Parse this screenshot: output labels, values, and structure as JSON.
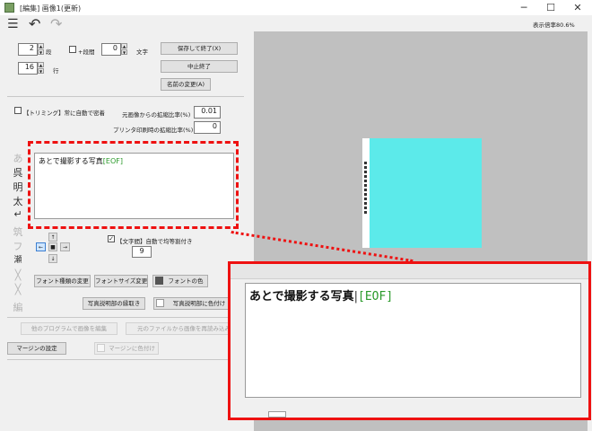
{
  "window": {
    "title": "[編集] 画像1(更新)",
    "min": "─",
    "max": "☐",
    "close": "✕",
    "zoom_label": "表示倍率80.6%"
  },
  "toolbar": {
    "menu_icon": "☰",
    "undo_icon": "↶",
    "redo_icon": "↷"
  },
  "layout": {
    "columns_value": "2",
    "columns_label": "段",
    "spacing_label": "+段間",
    "chars_value": "0",
    "chars_label": "文字",
    "rows_value": "16",
    "rows_label": "行"
  },
  "buttons": {
    "save_close": "保存して終了(X)",
    "cancel_close": "中止終了",
    "rename": "名前の変更(A)",
    "font_type": "フォント種類の変更",
    "font_size": "フォントサイズ変更",
    "font_color": "フォントの色",
    "caption_border": "写真説明部の縁取き",
    "caption_bg": "写真説明部に色付け",
    "other_program": "他のプログラムで画像を編集",
    "reload_file": "元のファイルから画像を再読み込み",
    "margin_settings": "マージンの設定",
    "margin_color": "マージンに色付け"
  },
  "trim": {
    "label": "【トリミング】常に自動で密着"
  },
  "ratios": {
    "original_label": "元画像からの拡縮比率(%)",
    "original_value": "0.01",
    "print_label": "プリンタ印刷時の拡縮比率(%)",
    "print_value": "0"
  },
  "tools": [
    "あ",
    "呉",
    "明",
    "太",
    "↵",
    "筑",
    "フ",
    "瀬",
    "╳",
    "╳",
    "編"
  ],
  "caption": {
    "text": "あとで撮影する写真",
    "eof": "[EOF]"
  },
  "arrows": {
    "up": "↑",
    "left": "←",
    "center": "■",
    "right": "→",
    "down": "↓"
  },
  "char_spacing": {
    "label": "【文字間】自動で均等割付き",
    "value": "9"
  },
  "colors": {
    "highlight": "#e11111",
    "page": "#5ceaea",
    "canvas": "#c0c0c0"
  }
}
